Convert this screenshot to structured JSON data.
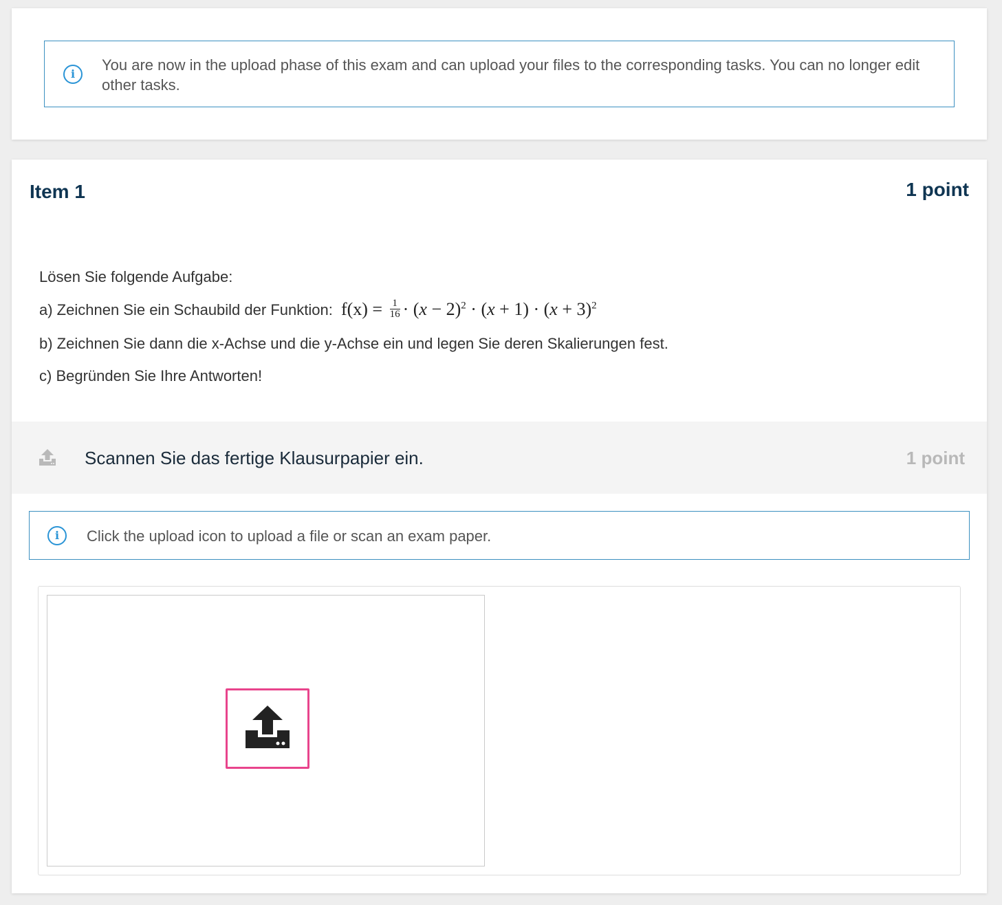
{
  "banner": {
    "info_text": "You are now in the upload phase of this exam and can upload your files to the corresponding tasks. You can no longer edit other tasks."
  },
  "item": {
    "title": "Item 1",
    "points": "1 point",
    "task": {
      "intro": "Lösen Sie folgende Aufgabe:",
      "a_label": "a) Zeichnen Sie ein Schaubild der Funktion:",
      "b": "b) Zeichnen Sie dann die x-Achse und die y-Achse ein und legen Sie deren Skalierungen fest.",
      "c": "c) Begründen Sie Ihre Antworten!"
    },
    "subtask": {
      "icon": "upload-icon",
      "label": "Scannen Sie das fertige Klausurpapier ein.",
      "points": "1 point"
    },
    "upload_info": "Click the upload icon to upload a file or scan an exam paper.",
    "upload_button_icon": "upload-icon"
  },
  "colors": {
    "info_border": "#3a8fc0",
    "info_icon": "#2a94d6",
    "title": "#0f3552",
    "upload_highlight": "#e8448c",
    "muted_points": "#b8b8b8"
  }
}
